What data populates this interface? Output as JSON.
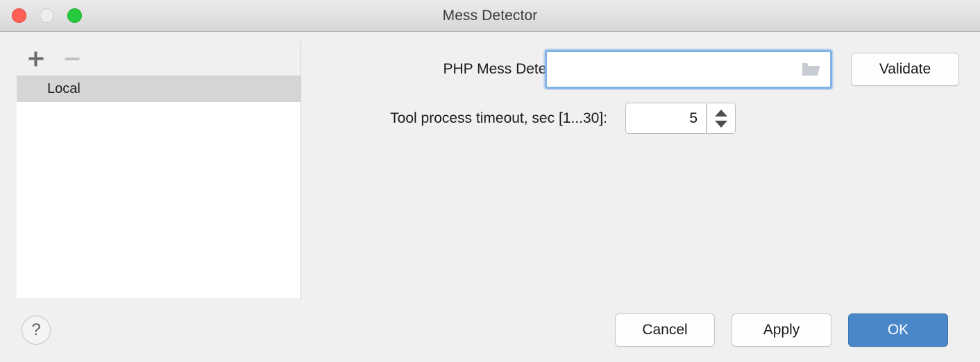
{
  "window": {
    "title": "Mess Detector",
    "traffic_lights": [
      {
        "name": "close",
        "color": "#ff5f56"
      },
      {
        "name": "minimize",
        "color": "#ededed"
      },
      {
        "name": "zoom",
        "color": "#27c93f"
      }
    ]
  },
  "sidebar": {
    "toolbar": {
      "add_label": "+",
      "remove_label": "−"
    },
    "items": [
      {
        "label": "Local",
        "selected": true
      }
    ]
  },
  "form": {
    "path": {
      "label": "PHP Mess Detector path:",
      "value": "",
      "placeholder": "",
      "browse_icon": "folder-icon",
      "focused": true
    },
    "timeout": {
      "label": "Tool process timeout, sec [1...30]:",
      "value": "5",
      "min": 1,
      "max": 30
    },
    "validate_label": "Validate"
  },
  "footer": {
    "help_label": "?",
    "cancel_label": "Cancel",
    "apply_label": "Apply",
    "ok_label": "OK"
  },
  "colors": {
    "accent": "#4a87c8",
    "focus_ring": "#81b2e6",
    "body_bg": "#f0f0f0",
    "selection_bg": "#d5d5d5"
  }
}
